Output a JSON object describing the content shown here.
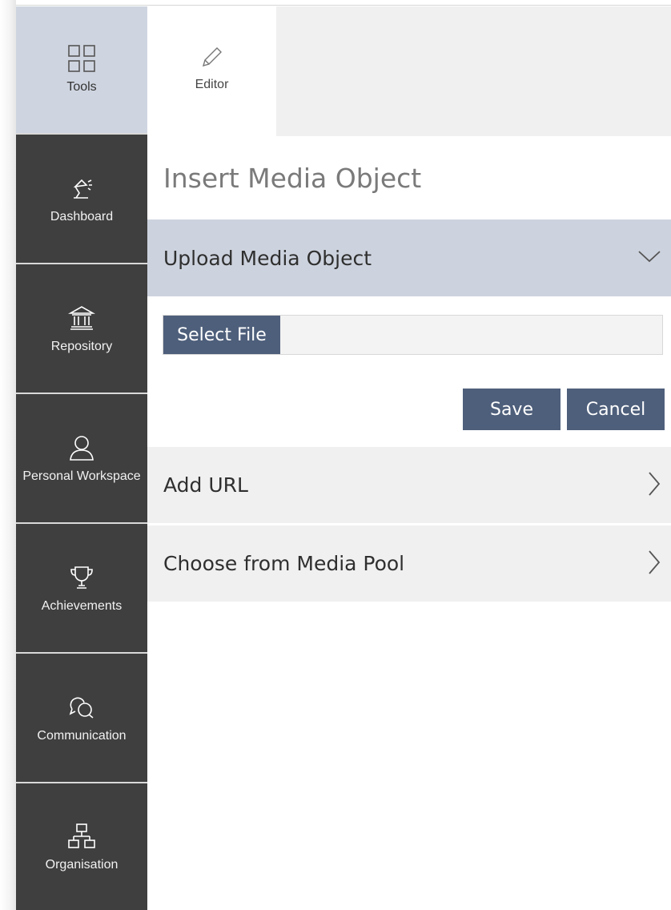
{
  "sidebar": {
    "items": [
      {
        "label": "Tools",
        "icon": "grid-icon",
        "active": true
      },
      {
        "label": "Dashboard",
        "icon": "desk-lamp-icon"
      },
      {
        "label": "Repository",
        "icon": "building-icon"
      },
      {
        "label": "Personal Workspace",
        "icon": "user-icon"
      },
      {
        "label": "Achievements",
        "icon": "trophy-icon"
      },
      {
        "label": "Communication",
        "icon": "chat-bubbles-icon"
      },
      {
        "label": "Organisation",
        "icon": "org-chart-icon"
      }
    ]
  },
  "tabs": {
    "editor": {
      "label": "Editor",
      "icon": "pencil-icon"
    }
  },
  "main": {
    "title": "Insert Media Object",
    "upload": {
      "title": "Upload Media Object",
      "select_file_label": "Select File",
      "file_name": "",
      "save_label": "Save",
      "cancel_label": "Cancel"
    },
    "add_url": {
      "title": "Add URL"
    },
    "media_pool": {
      "title": "Choose from Media Pool"
    }
  },
  "colors": {
    "sidebar_bg": "#3f3f3f",
    "active_bg": "#cfd5e0",
    "button_bg": "#4e5f7b",
    "accordion_open_bg": "#cdd3de",
    "accordion_bg": "#f0f0f0"
  }
}
